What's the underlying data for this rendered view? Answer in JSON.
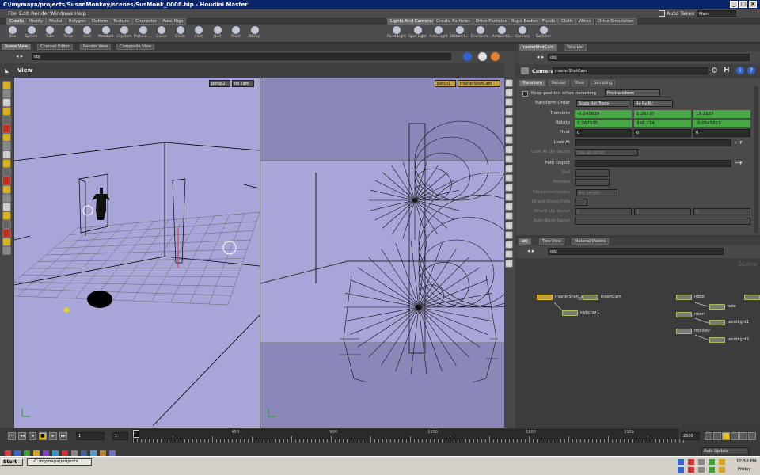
{
  "window": {
    "title": "C:/mymaya/projects/SusanMonkey/scenes/SusMonk_0008.hip - Houdini Master"
  },
  "menus": [
    "File",
    "Edit",
    "Render",
    "Windows",
    "Help"
  ],
  "desktop": {
    "label": "Main",
    "auto_takes": "Auto Takes"
  },
  "shelf_tabs_left": [
    "Create",
    "Modify",
    "Model",
    "Polygon",
    "Deform",
    "Texture",
    "Character",
    "Auto Rigs"
  ],
  "shelf_tabs_right": [
    "Lights And Cameras",
    "Create Particles",
    "Drive Particles",
    "Rigid Bodies",
    "Fluids",
    "Cloth",
    "Wires",
    "Drive Simulation"
  ],
  "tools_left": [
    {
      "label": "Box",
      "icon": "box-icon"
    },
    {
      "label": "Sphere",
      "icon": "sphere-icon"
    },
    {
      "label": "Tube",
      "icon": "tube-icon"
    },
    {
      "label": "Torus",
      "icon": "torus-icon"
    },
    {
      "label": "Grid",
      "icon": "grid-icon"
    },
    {
      "label": "Metaball",
      "icon": "metaball-icon"
    },
    {
      "label": "LSystem",
      "icon": "lsystem-icon"
    },
    {
      "label": "Platonic ...",
      "icon": "platonic-icon"
    },
    {
      "label": "Curve",
      "icon": "curve-icon"
    },
    {
      "label": "Circle",
      "icon": "circle-icon"
    },
    {
      "label": "Font",
      "icon": "font-icon"
    },
    {
      "label": "Null",
      "icon": "null-icon"
    },
    {
      "label": "Rivet",
      "icon": "rivet-icon"
    },
    {
      "label": "Sticky",
      "icon": "sticky-icon"
    }
  ],
  "tools_right": [
    {
      "label": "Point Light",
      "icon": "point-light-icon"
    },
    {
      "label": "Spot Light",
      "icon": "spot-light-icon"
    },
    {
      "label": "Area Light",
      "icon": "area-light-icon"
    },
    {
      "label": "Distant L...",
      "icon": "distant-light-icon"
    },
    {
      "label": "Environm...",
      "icon": "environment-light-icon"
    },
    {
      "label": "Ambient L...",
      "icon": "ambient-light-icon"
    },
    {
      "label": "Camera",
      "icon": "camera-icon"
    },
    {
      "label": "Switcher",
      "icon": "switcher-icon"
    }
  ],
  "viewer": {
    "tabs": [
      "Scene View",
      "Channel Editor",
      "Render View",
      "Composite View"
    ],
    "path": "obj",
    "title": "View",
    "left_cam": {
      "persp": "persp2",
      "cam": "no cam"
    },
    "right_cam": {
      "persp": "persp1",
      "cam": "masterShotCam"
    }
  },
  "params": {
    "tabs_top": [
      "masterShotCam",
      "Take List"
    ],
    "path": "obj",
    "node_type": "Camera",
    "node_name": "masterShotCam",
    "tabs": [
      "Transform",
      "Render",
      "View",
      "Sampling"
    ],
    "keep_position": "Keep position when parenting",
    "keep_mode": "Pre-transform",
    "transform_order_label": "Transform Order",
    "transform_order": "Scale Rot Trans",
    "rot_order": "Rx Ry Rz",
    "translate_label": "Translate",
    "translate": [
      "-0.245839",
      "1.26737",
      "15.2187"
    ],
    "rotate_label": "Rotate",
    "rotate": [
      "0.367935",
      "366.214",
      "-0.0545619"
    ],
    "pivot_label": "Pivot",
    "pivot": [
      "0",
      "0",
      "0"
    ],
    "look_at": "Look At",
    "look_at_up": "Look At Up Vector",
    "use_up": "Use up vector",
    "path_object": "Path Object",
    "roll": "Roll",
    "position": "Position",
    "param": "Parameterization",
    "arc": "Arc Length",
    "orient_path": "Orient Along Path",
    "orient_up": "Orient Up Vector",
    "bank": "Auto-Bank factor",
    "up_vals": [
      "0",
      "1",
      "0"
    ]
  },
  "network": {
    "tabs": [
      "obj",
      "Tree View",
      "Material Palette"
    ],
    "path": "obj",
    "scene_label": "Scene",
    "nodes": [
      {
        "name": "masterShotCam",
        "sel": true
      },
      {
        "name": "insertCam"
      },
      {
        "name": "switcher1"
      },
      {
        "name": "robot"
      },
      {
        "name": "pole"
      },
      {
        "name": "room"
      },
      {
        "name": "pointlight1"
      },
      {
        "name": "monkey"
      },
      {
        "name": "pointlight2"
      },
      {
        "name": ""
      }
    ]
  },
  "timeline": {
    "frame": "1",
    "start": "1",
    "end": "2500",
    "ticks": [
      "1",
      "450",
      "900",
      "1350",
      "1800",
      "2250"
    ],
    "auto_update": "Auto Update"
  },
  "taskbar": {
    "start": "Start",
    "task": "C:/mymaya/projects...",
    "time": "12:58 PM",
    "day": "Friday"
  },
  "colors": {
    "param_green": "#45a845",
    "viewport": "#a8a6d8",
    "selected_node": "#e8c020"
  }
}
